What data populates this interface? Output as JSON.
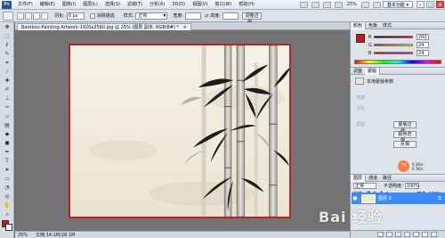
{
  "app": {
    "logo_text": "Ps"
  },
  "menubar": {
    "items": [
      "文件(F)",
      "编辑(E)",
      "图像(I)",
      "图层(L)",
      "选择(S)",
      "滤镜(T)",
      "分析(A)",
      "3D(D)",
      "视图(V)",
      "窗口(W)",
      "帮助(H)"
    ],
    "zoom": "25%",
    "workspace": "基本功能 ▾"
  },
  "optionsbar": {
    "feather_label": "羽化:",
    "feather_value": "0 px",
    "antialias_label": "消除锯齿",
    "style_label": "样式:",
    "style_value": "正常",
    "width_label": "宽度:",
    "height_label": "高度:",
    "refine_button": "调整边缘..."
  },
  "document": {
    "tab_title": "Bamboo-Painting-Artwork-1920x2560.jpg @ 25% (图层 副本, RGB/8#) *",
    "close_symbol": "×"
  },
  "statusbar": {
    "zoom": "25%",
    "doc_info": "文档:14.1M/28.1M"
  },
  "panels": {
    "color_tabs": [
      "颜色",
      "色板",
      "样式"
    ],
    "color_channels": [
      {
        "name": "R",
        "value": "200"
      },
      {
        "name": "G",
        "value": "24"
      },
      {
        "name": "B",
        "value": "24"
      }
    ],
    "adjust_tabs": [
      "调整",
      "蒙版"
    ],
    "preset_label": "本地蒙版参数",
    "adjust_faint": [
      "浓度:",
      "羽化:",
      "调整:"
    ],
    "adjust_buttons": [
      "蒙版边缘...",
      "颜色范围...",
      "反相"
    ],
    "layers_tabs": [
      "图层",
      "通道",
      "路径"
    ],
    "blend_mode": "正常",
    "opacity_label": "不透明度:",
    "opacity_value": "100%",
    "lock_label": "锁定:",
    "fill_label": "填充: 100%",
    "layer_name": "图层 0"
  },
  "overlay": {
    "badge_value": "76",
    "info_line1": "0.2K/s",
    "info_line2": "0.7K/s"
  },
  "watermark": "Bai 经验"
}
